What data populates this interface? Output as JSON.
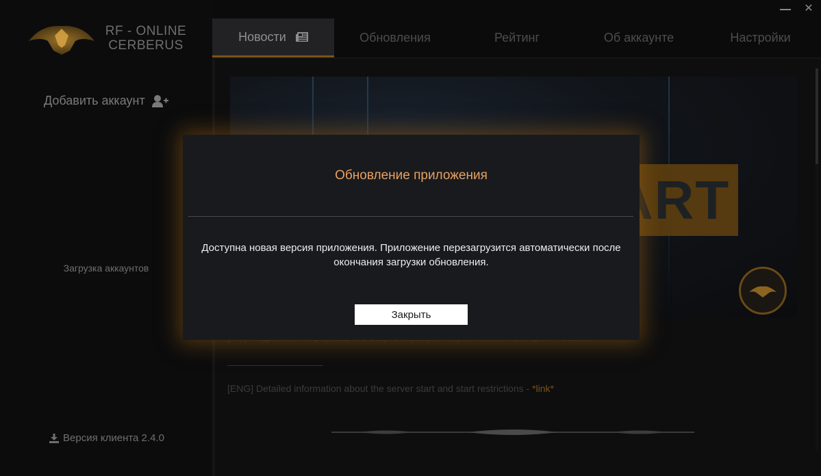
{
  "window": {
    "minimize_label": "",
    "close_label": "✕"
  },
  "sidebar": {
    "brand_line1": "RF - ONLINE",
    "brand_line2": "CERBERUS",
    "add_account": "Добавить аккаунт",
    "loading_accounts": "Загрузка аккаунтов",
    "client_version": "Версия клиента 2.4.0"
  },
  "tabs": [
    {
      "label": "Новости",
      "active": true
    },
    {
      "label": "Обновления",
      "active": false
    },
    {
      "label": "Рейтинг",
      "active": false
    },
    {
      "label": "Об аккаунте",
      "active": false
    },
    {
      "label": "Настройки",
      "active": false
    }
  ],
  "news": {
    "banner_text": "SERVER START",
    "ru_line": "[RU] Подробная информация о старте сервера и ограничения на старте - *ссылка*",
    "eng_line": "[ENG] Detailed information about the server start and start restrictions - ",
    "eng_link": "*link*"
  },
  "modal": {
    "title": "Обновление приложения",
    "message_line1": "Доступна новая версия приложения. Приложение перезагрузится автоматически после",
    "message_line2": "окончания загрузки обновления.",
    "close_button": "Закрыть"
  },
  "colors": {
    "accent": "#7a5418",
    "modal_title": "#e8a161",
    "modal_glow": "#8c5a14"
  }
}
